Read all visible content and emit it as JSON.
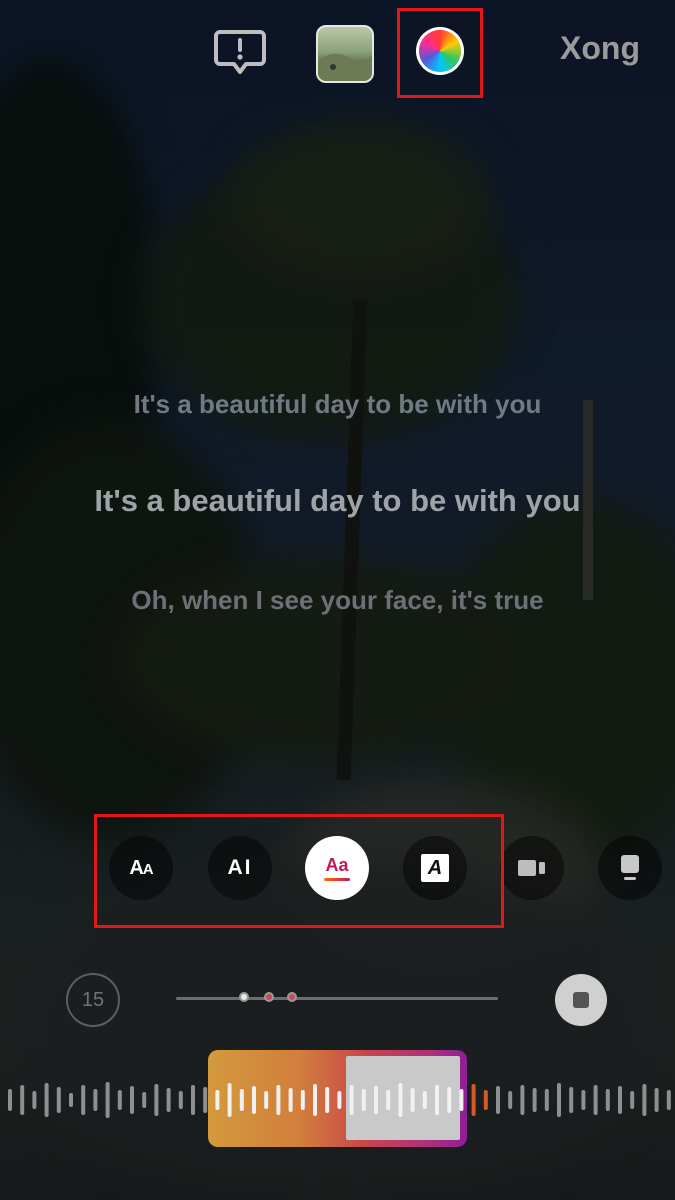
{
  "top_bar": {
    "report_icon": "alert-bubble-icon",
    "thumbnail_icon": "album-thumbnail",
    "thumbnail_text": "",
    "color_icon": "color-wheel-icon",
    "done_label": "Xong"
  },
  "lyrics": {
    "previous": "It's a beautiful day to be with you",
    "current": "It's a beautiful day to be with you",
    "next": "Oh, when I see your face, it's true"
  },
  "lyric_styles": [
    {
      "name": "style-classic",
      "glyph": "AA",
      "selected": false
    },
    {
      "name": "style-typewriter",
      "glyph": "AI",
      "selected": false
    },
    {
      "name": "style-highlight",
      "glyph": "Aa",
      "selected": true
    },
    {
      "name": "style-boxed",
      "glyph": "A",
      "selected": false
    },
    {
      "name": "style-video",
      "glyph": "video-card-icon",
      "selected": false
    },
    {
      "name": "style-card",
      "glyph": "card-icon",
      "selected": false
    }
  ],
  "playback": {
    "rewind_label": "15",
    "stop_icon": "stop-icon",
    "progress_markers": [
      0.21,
      0.29,
      0.36
    ]
  },
  "clip_selector": {
    "accent_start": "#d39a3c",
    "accent_end": "#8f1f98"
  },
  "colors": {
    "highlight_box": "#e3161b",
    "selected_style_text": "#c2185b"
  }
}
